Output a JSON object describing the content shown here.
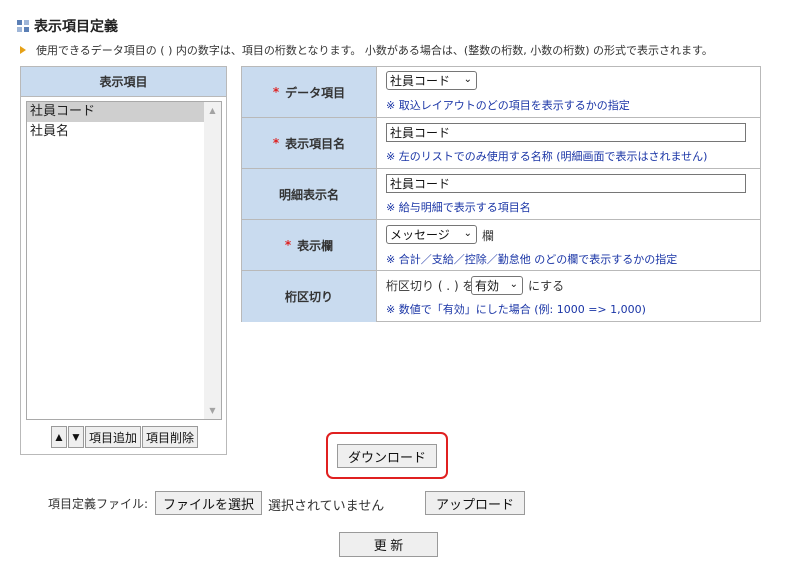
{
  "title": "表示項目定義",
  "note": "使用できるデータ項目の ( ) 内の数字は、項目の桁数となります。 小数がある場合は、(整数の桁数, 小数の桁数) の形式で表示されます。",
  "left_panel": {
    "header": "表示項目",
    "items": [
      "社員コード",
      "社員名"
    ],
    "selected_index": 0,
    "buttons": {
      "up": "▲",
      "down": "▼",
      "add": "項目追加",
      "delete": "項目削除"
    }
  },
  "rows": [
    {
      "label": "データ項目",
      "required": true,
      "select": "社員コード",
      "hint": "※ 取込レイアウトのどの項目を表示するかの指定"
    },
    {
      "label": "表示項目名",
      "required": true,
      "input": "社員コード",
      "hint": "※ 左のリストでのみ使用する名称 (明細画面で表示はされません)"
    },
    {
      "label": "明細表示名",
      "required": false,
      "input": "社員コード",
      "hint": "※ 給与明細で表示する項目名"
    },
    {
      "label": "表示欄",
      "required": true,
      "select": "メッセージ",
      "suffix": "欄",
      "hint": "※ 合計／支給／控除／勤怠他 のどの欄で表示するかの指定"
    },
    {
      "label": "桁区切り",
      "required": false,
      "prefix": "桁区切り ( . ) を",
      "select": "有効",
      "suffix": "にする",
      "hint": "※ 数値で「有効」にした場合 (例: 1000  =>  1,000)"
    }
  ],
  "required_mark": "*",
  "download_label": "ダウンロード",
  "upload": {
    "label": "項目定義ファイル:",
    "choose_file": "ファイルを選択",
    "no_file": "選択されていません",
    "upload_button": "アップロード"
  },
  "update_label": "更 新",
  "icons": {
    "title_icon": "grid-squares-icon",
    "note_icon": "triangle-right-icon",
    "select_arrow": "chevron-down-icon"
  },
  "colors": {
    "header_bg": "#c9dbef",
    "hint_text": "#1a35a6",
    "required": "#d22222",
    "download_highlight": "#e02020"
  }
}
